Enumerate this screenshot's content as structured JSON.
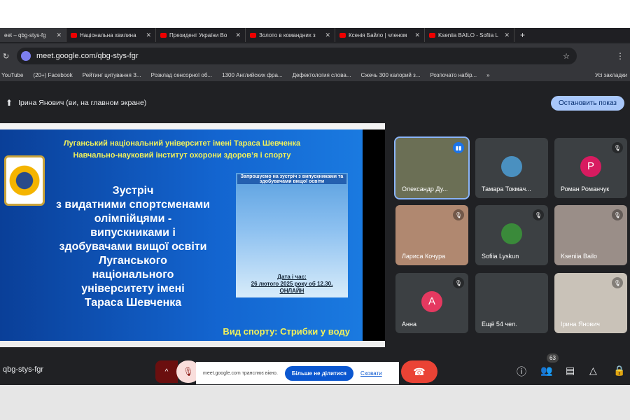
{
  "browser": {
    "tabs": [
      {
        "label": "eet – qbg-stys-fg",
        "active": true
      },
      {
        "label": "Національна хвилина"
      },
      {
        "label": "Президент України Во"
      },
      {
        "label": "Золото в командних з"
      },
      {
        "label": "Ксенія Байло | членом"
      },
      {
        "label": "Kseniia BAILO - Sofiia L"
      }
    ],
    "url": "meet.google.com/qbg-stys-fgr",
    "bookmarks": [
      "YouTube",
      "(20+) Facebook",
      "Рейтинг цитування З...",
      "Розклад сенсорної об...",
      "1300 Английских фра...",
      "Дефектология слова...",
      "Сжечь 300 калорий з...",
      "Розпочато набір...",
      "»",
      "Усі закладки"
    ]
  },
  "meet": {
    "presenter_banner": "Ірина Янович (ви, на главном экране)",
    "stop_button": "Остановить показ",
    "slide": {
      "header1": "Луганський національний університет імені Тараса Шевченка",
      "header2": "Навчально-науковий інститут охорони здоров’я і спорту",
      "title_lines": [
        "Зустріч",
        "з видатними спортсменами",
        "олімпійцями -",
        "випускниками і",
        "здобувачами вищої освіти",
        "Луганського",
        "національного",
        "університету імені",
        "Тараса Шевченка"
      ],
      "poster_title": "Запрошуємо на зустріч з випускниками та здобувачами вищої освіти",
      "poster_date": "Дата і час:",
      "poster_datetime": "26 лютого 2025 року об 12.30,",
      "poster_online": "ОНЛАЙН",
      "sport": "Вид спорту: Стрибки у воду"
    },
    "participants": [
      {
        "name": "Олександр Ду...",
        "speaking": true,
        "bg": "#6b6f55"
      },
      {
        "name": "Тамара Токмач...",
        "muted": false,
        "bg": "#3c4043",
        "avatar_color": "#4a90c0"
      },
      {
        "name": "Роман Романчук",
        "muted": true,
        "initial": "P",
        "avatar_color": "#d81b60"
      },
      {
        "name": "Лариса Кочура",
        "muted": true,
        "bg": "#b08870"
      },
      {
        "name": "Sofiia Lyskun",
        "muted": true,
        "avatar_color": "#3a8a3a"
      },
      {
        "name": "Kseniia Bailo",
        "muted": true,
        "bg": "#9a8e88"
      },
      {
        "name": "Анна",
        "muted": true,
        "initial": "A",
        "avatar_color": "#e53960"
      },
      {
        "name": "Ещё 54 чел.",
        "muted": false
      },
      {
        "name": "Ірина Янович",
        "muted": true,
        "bg": "#c9c2b8"
      }
    ],
    "meeting_code": "qbg-stys-fgr",
    "share_popup": {
      "text": "meet.google.com транслює вікно.",
      "stop": "Більше не ділитися",
      "hide": "Сховати"
    },
    "people_count": "63"
  }
}
